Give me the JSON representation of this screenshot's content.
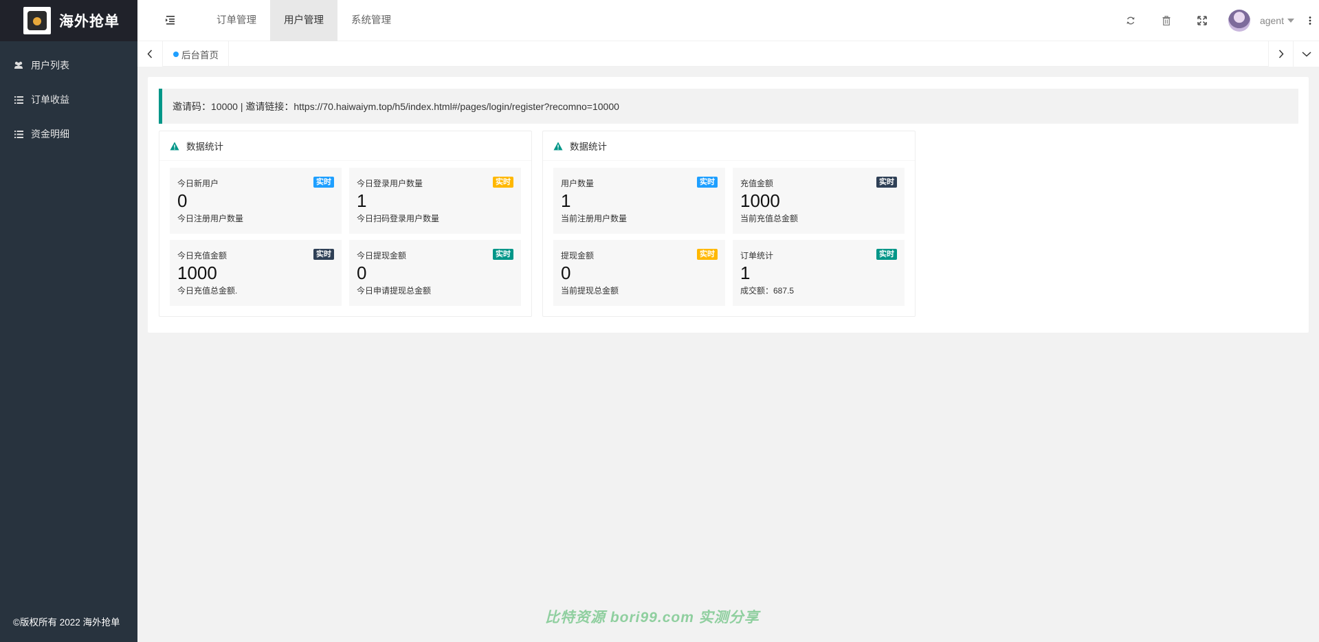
{
  "sidebar": {
    "logo_title": "海外抢单",
    "items": [
      {
        "label": "用户列表",
        "icon": "users-icon"
      },
      {
        "label": "订单收益",
        "icon": "list-icon"
      },
      {
        "label": "资金明细",
        "icon": "list-icon"
      }
    ],
    "copyright": "©版权所有 2022 海外抢单"
  },
  "header": {
    "nav": [
      {
        "label": "订单管理",
        "active": false
      },
      {
        "label": "用户管理",
        "active": true
      },
      {
        "label": "系统管理",
        "active": false
      }
    ],
    "user_name": "agent"
  },
  "tabs": {
    "current": "后台首页"
  },
  "notice": {
    "text": "邀请码：10000 | 邀请链接：https://70.haiwaiym.top/h5/index.html#/pages/login/register?recomno=10000"
  },
  "cards": [
    {
      "title": "数据统计",
      "stats": [
        {
          "title": "今日新用户",
          "badge": "实时",
          "badge_color": "#1e9fff",
          "value": "0",
          "desc": "今日注册用户数量"
        },
        {
          "title": "今日登录用户数量",
          "badge": "实时",
          "badge_color": "#ffb800",
          "value": "1",
          "desc": "今日扫码登录用户数量"
        },
        {
          "title": "今日充值金额",
          "badge": "实时",
          "badge_color": "#2f4056",
          "value": "1000",
          "desc": "今日充值总金额."
        },
        {
          "title": "今日提现金额",
          "badge": "实时",
          "badge_color": "#009688",
          "value": "0",
          "desc": "今日申请提现总金额"
        }
      ]
    },
    {
      "title": "数据统计",
      "stats": [
        {
          "title": "用户数量",
          "badge": "实时",
          "badge_color": "#1e9fff",
          "value": "1",
          "desc": "当前注册用户数量"
        },
        {
          "title": "充值金额",
          "badge": "实时",
          "badge_color": "#2f4056",
          "value": "1000",
          "desc": "当前充值总金额"
        },
        {
          "title": "提现金额",
          "badge": "实时",
          "badge_color": "#ffb800",
          "value": "0",
          "desc": "当前提现总金额"
        },
        {
          "title": "订单统计",
          "badge": "实时",
          "badge_color": "#009688",
          "value": "1",
          "desc": "成交额：687.5"
        }
      ]
    }
  ],
  "watermark": "比特资源 bori99.com 实测分享",
  "colors": {
    "sidebar_bg": "#28333e",
    "logo_bg": "#20222a",
    "accent": "#009688"
  }
}
